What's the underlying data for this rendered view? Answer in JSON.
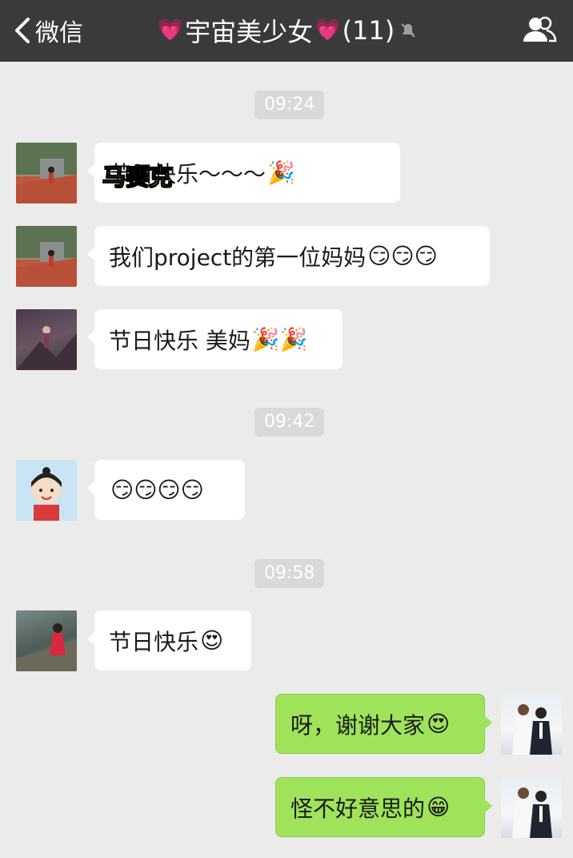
{
  "nav": {
    "back_label": "微信",
    "title": "宇宙美少女",
    "member_count": "(11)",
    "title_heart": "💗"
  },
  "timestamps": [
    "09:24",
    "09:42",
    "09:58"
  ],
  "name_overlay": "马赛克",
  "messages": [
    {
      "text": "节日快乐～～～",
      "emoji": "🎉"
    },
    {
      "text": "我们project的第一位妈妈",
      "emoji": "😏😏😏"
    },
    {
      "text": "节日快乐 美妈",
      "emoji": "🎉🎉"
    },
    {
      "text": "",
      "emoji": "😏😏😏😏"
    },
    {
      "text": "节日快乐",
      "emoji": "😍"
    },
    {
      "text": "呀，谢谢大家",
      "emoji": "😍"
    },
    {
      "text": "怪不好意思的",
      "emoji": "😁"
    }
  ],
  "colors": {
    "topbar": "#3a3a3d",
    "background": "#ebebeb",
    "sent_bubble": "#9fe35a",
    "received_bubble": "#ffffff"
  }
}
